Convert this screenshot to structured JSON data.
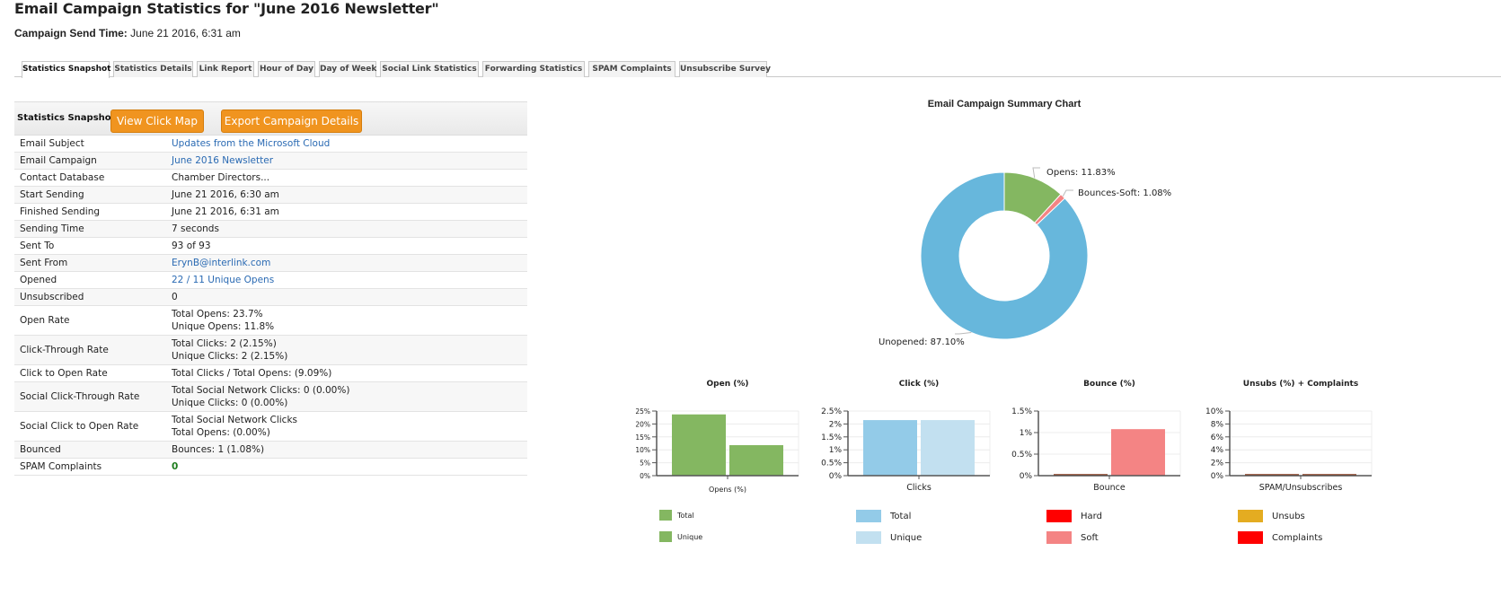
{
  "page": {
    "title": "Email Campaign Statistics for \"June 2016 Newsletter\"",
    "send_time_label": "Campaign Send Time:",
    "send_time_value": " June 21 2016, 6:31 am"
  },
  "tabs": [
    {
      "label": "Statistics Snapshot",
      "active": true
    },
    {
      "label": "Statistics Details"
    },
    {
      "label": "Link Report"
    },
    {
      "label": "Hour of Day"
    },
    {
      "label": "Day of Week"
    },
    {
      "label": "Social Link Statistics"
    },
    {
      "label": "Forwarding Statistics"
    },
    {
      "label": "SPAM Complaints"
    },
    {
      "label": "Unsubscribe Survey"
    }
  ],
  "snapshot": {
    "header_label": "Statistics Snapshot",
    "view_click_map_label": "View Click Map",
    "export_label": "Export Campaign Details",
    "rows": [
      {
        "key": "Email Subject",
        "lines": [
          "Updates from the Microsoft Cloud"
        ],
        "link": true
      },
      {
        "key": "Email Campaign",
        "lines": [
          "June 2016 Newsletter"
        ],
        "link": true
      },
      {
        "key": "Contact Database",
        "lines": [
          "Chamber Directors..."
        ]
      },
      {
        "key": "Start Sending",
        "lines": [
          "June 21 2016, 6:30 am"
        ]
      },
      {
        "key": "Finished Sending",
        "lines": [
          "June 21 2016, 6:31 am"
        ]
      },
      {
        "key": "Sending Time",
        "lines": [
          "7 seconds"
        ]
      },
      {
        "key": "Sent To",
        "lines": [
          "93 of 93"
        ]
      },
      {
        "key": "Sent From",
        "lines": [
          "ErynB@interlink.com"
        ],
        "link": true
      },
      {
        "key": "Opened",
        "lines": [
          "22 / 11 Unique Opens"
        ],
        "link": true
      },
      {
        "key": "Unsubscribed",
        "lines": [
          "0"
        ]
      },
      {
        "key": "Open Rate",
        "lines": [
          "Total Opens: 23.7%",
          "Unique Opens: 11.8%"
        ]
      },
      {
        "key": "Click-Through Rate",
        "lines": [
          "Total Clicks: 2 (2.15%)",
          "Unique Clicks: 2 (2.15%)"
        ]
      },
      {
        "key": "Click to Open Rate",
        "lines": [
          "Total Clicks / Total Opens: (9.09%)"
        ]
      },
      {
        "key": "Social Click-Through Rate",
        "lines": [
          "Total Social Network Clicks: 0 (0.00%)",
          "Unique Clicks: 0 (0.00%)"
        ]
      },
      {
        "key": "Social Click to Open Rate",
        "lines": [
          "Total Social Network Clicks",
          "Total Opens: (0.00%)"
        ]
      },
      {
        "key": "Bounced",
        "lines": [
          "Bounces: 1 (1.08%)"
        ]
      },
      {
        "key": "SPAM Complaints",
        "lines": [
          "0"
        ],
        "green": true
      }
    ]
  },
  "colors": {
    "opens": "#84b761",
    "unopened": "#67b7dc",
    "bounce_soft": "#f48484",
    "bounce_hard": "#ff0000",
    "clicks_total": "#93cbe8",
    "clicks_unique": "#c2e0f0",
    "unsubs": "#e4ac21",
    "complaints": "#ff0000",
    "button": "#f0941f"
  },
  "chart_data": [
    {
      "type": "pie",
      "title": "Email Campaign Summary Chart",
      "donut": true,
      "slices": [
        {
          "label": "Opens",
          "value": 11.83,
          "display": "Opens: 11.83%",
          "color": "#84b761"
        },
        {
          "label": "Bounces-Soft",
          "value": 1.08,
          "display": "Bounces-Soft: 1.08%",
          "color": "#f48484"
        },
        {
          "label": "Unopened",
          "value": 87.1,
          "display": "Unopened: 87.10%",
          "color": "#67b7dc"
        }
      ]
    },
    {
      "type": "bar",
      "title": "Open (%)",
      "categories": [
        "Opens (%)"
      ],
      "xlabel": "Opens (%)",
      "ylim": [
        0,
        25
      ],
      "yticks": [
        "0%",
        "5%",
        "10%",
        "15%",
        "20%",
        "25%"
      ],
      "series": [
        {
          "name": "Total",
          "values": [
            23.7
          ],
          "color": "#84b761"
        },
        {
          "name": "Unique",
          "values": [
            11.8
          ],
          "color": "#84b761"
        }
      ]
    },
    {
      "type": "bar",
      "title": "Click (%)",
      "categories": [
        "Clicks"
      ],
      "xlabel": "Clicks",
      "ylim": [
        0,
        2.5
      ],
      "yticks": [
        "0%",
        "0.5%",
        "1%",
        "1.5%",
        "2%",
        "2.5%"
      ],
      "series": [
        {
          "name": "Total",
          "values": [
            2.15
          ],
          "color": "#93cbe8"
        },
        {
          "name": "Unique",
          "values": [
            2.15
          ],
          "color": "#c2e0f0"
        }
      ]
    },
    {
      "type": "bar",
      "title": "Bounce (%)",
      "categories": [
        "Bounce"
      ],
      "xlabel": "Bounce",
      "ylim": [
        0,
        1.5
      ],
      "yticks": [
        "0%",
        "0.5%",
        "1%",
        "1.5%"
      ],
      "series": [
        {
          "name": "Hard",
          "values": [
            0
          ],
          "color": "#ff0000"
        },
        {
          "name": "Soft",
          "values": [
            1.08
          ],
          "color": "#f48484"
        }
      ]
    },
    {
      "type": "bar",
      "title": "Unsubs (%) + Complaints",
      "categories": [
        "SPAM/Unsubscribes"
      ],
      "xlabel": "SPAM/Unsubscribes",
      "ylim": [
        0,
        10
      ],
      "yticks": [
        "0%",
        "2%",
        "4%",
        "6%",
        "8%",
        "10%"
      ],
      "series": [
        {
          "name": "Unsubs",
          "values": [
            0
          ],
          "color": "#e4ac21"
        },
        {
          "name": "Complaints",
          "values": [
            0
          ],
          "color": "#ff0000"
        }
      ]
    }
  ]
}
